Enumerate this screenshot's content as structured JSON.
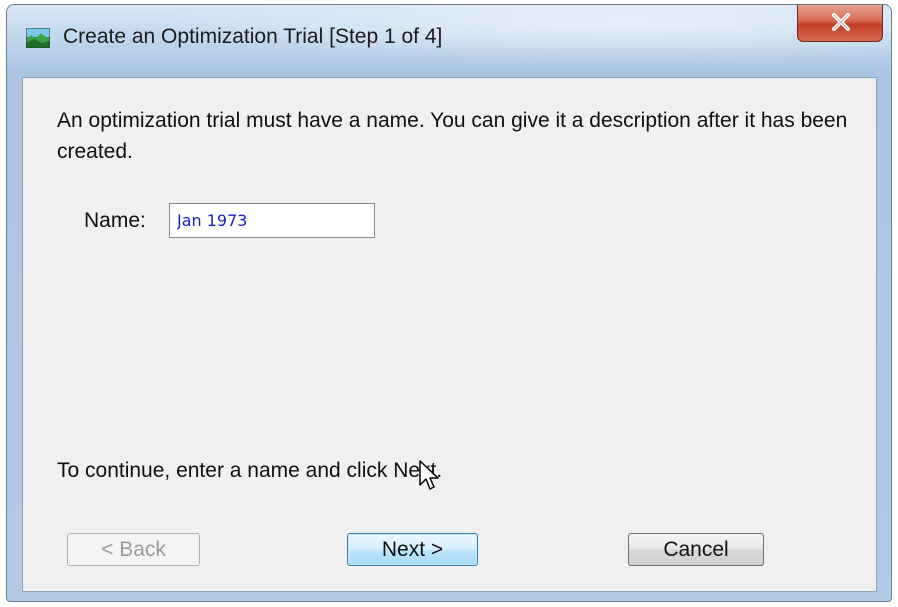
{
  "window": {
    "title": "Create an Optimization Trial [Step 1 of 4]",
    "app_icon": "landscape-icon",
    "close_icon": "close-icon"
  },
  "content": {
    "description": "An optimization trial must have a name. You can give it a description after it has been created.",
    "name_label": "Name:",
    "name_value": "Jan 1973",
    "hint": "To continue, enter a name and click Next."
  },
  "buttons": {
    "back_label": "< Back",
    "back_enabled": false,
    "next_label": "Next >",
    "cancel_label": "Cancel"
  },
  "colors": {
    "input_text": "#1d1dcc",
    "close_button": "#c33d24",
    "focus_button_border": "#3c7fb1"
  }
}
